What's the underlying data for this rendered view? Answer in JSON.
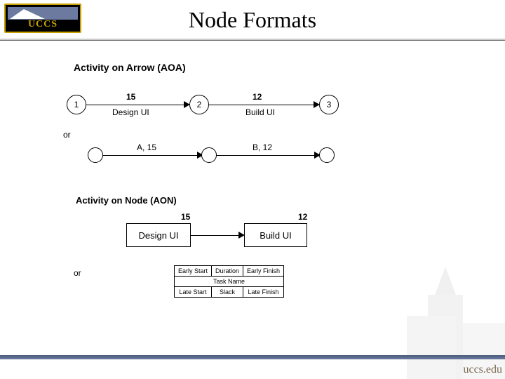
{
  "brand": {
    "logo_text": "UCCS",
    "footer_url": "uccs.edu"
  },
  "title": "Node Formats",
  "sections": {
    "aoa_heading": "Activity on Arrow (AOA)",
    "aon_heading": "Activity on Node (AON)",
    "or": "or"
  },
  "aoa": {
    "nodes": {
      "n1": "1",
      "n2": "2",
      "n3": "3"
    },
    "edges": {
      "e12": {
        "top": "15",
        "bot": "Design UI"
      },
      "e23": {
        "top": "12",
        "bot": "Build UI"
      }
    }
  },
  "aoa_alt": {
    "edges": {
      "e12": {
        "top": "A, 15"
      },
      "e23": {
        "top": "B, 12"
      }
    }
  },
  "aon": {
    "nodes": {
      "n1": {
        "label": "Design UI",
        "corner": "15"
      },
      "n2": {
        "label": "Build UI",
        "corner": "12"
      }
    }
  },
  "aon_template": {
    "r1c1": "Early Start",
    "r1c2": "Duration",
    "r1c3": "Early Finish",
    "r2": "Task Name",
    "r3c1": "Late Start",
    "r3c2": "Slack",
    "r3c3": "Late Finish"
  }
}
